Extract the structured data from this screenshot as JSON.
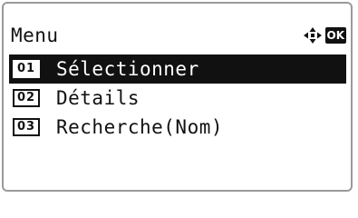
{
  "screen": {
    "title": "Menu",
    "nav_icon": "four-way-arrow-icon",
    "ok_label": "OK"
  },
  "menu": {
    "items": [
      {
        "number": "01",
        "label": "Sélectionner",
        "selected": true
      },
      {
        "number": "02",
        "label": "Détails",
        "selected": false
      },
      {
        "number": "03",
        "label": "Recherche(Nom)",
        "selected": false
      }
    ]
  },
  "colors": {
    "text": "#111111",
    "selection_bg": "#111111",
    "selection_text": "#ffffff",
    "frame": "#9a9a9a"
  }
}
